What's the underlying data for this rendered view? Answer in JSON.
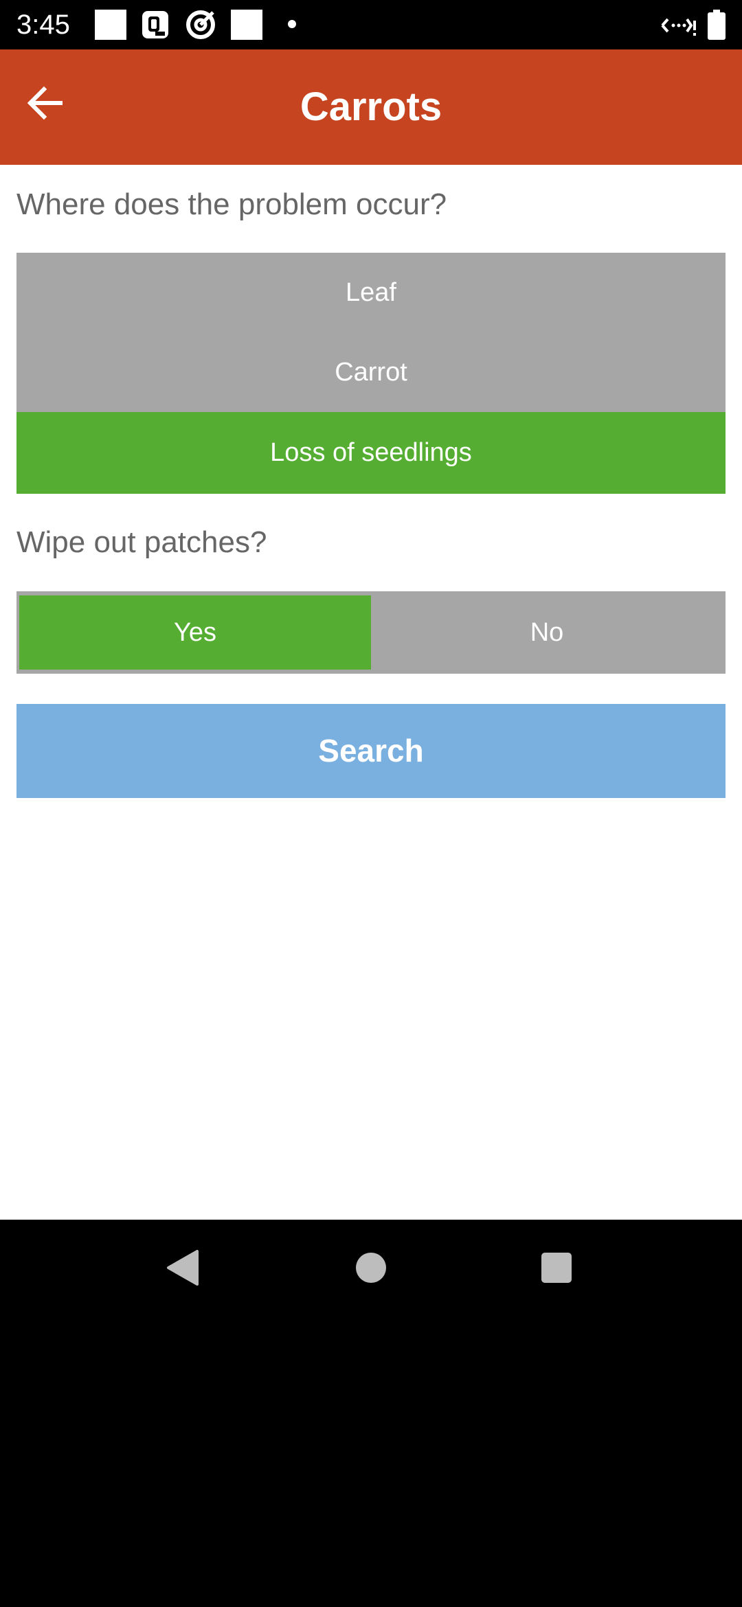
{
  "status_bar": {
    "time": "3:45",
    "icons": [
      "notification-square-icon",
      "d-app-icon",
      "target-app-icon",
      "notification-square-icon",
      "dot-icon",
      "signal-icon",
      "battery-icon"
    ]
  },
  "app_bar": {
    "title": "Carrots",
    "back_icon": "arrow-left-icon"
  },
  "question1": {
    "text": "Where does the problem occur?",
    "options": [
      {
        "label": "Leaf",
        "selected": false
      },
      {
        "label": "Carrot",
        "selected": false
      },
      {
        "label": "Loss of seedlings",
        "selected": true
      }
    ]
  },
  "question2": {
    "text": "Wipe out patches?",
    "options": [
      {
        "label": "Yes",
        "selected": true
      },
      {
        "label": "No",
        "selected": false
      }
    ]
  },
  "search": {
    "label": "Search"
  },
  "nav_bar": {
    "icons": [
      "back-triangle-icon",
      "home-circle-icon",
      "recents-square-icon"
    ]
  },
  "colors": {
    "app_bar": "#c6441f",
    "selected": "#55ae32",
    "unselected": "#a6a6a6",
    "search_button": "#7ab0e0"
  }
}
